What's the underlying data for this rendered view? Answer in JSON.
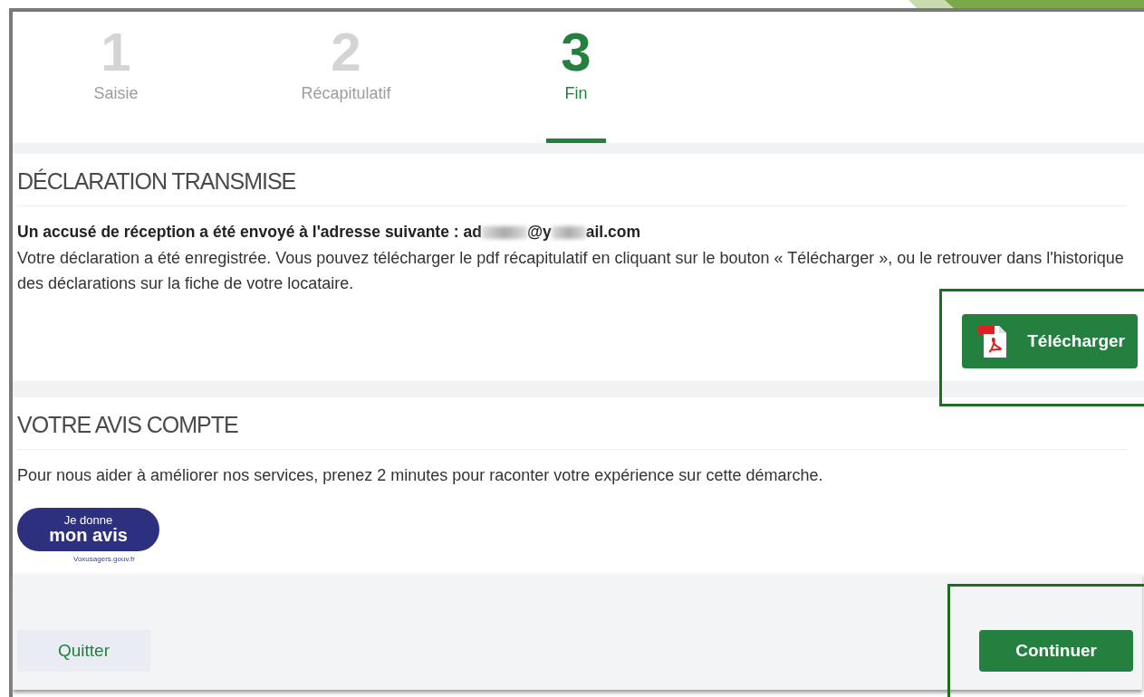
{
  "steps": [
    {
      "number": "1",
      "label": "Saisie",
      "selected": false
    },
    {
      "number": "2",
      "label": "Récapitulatif",
      "selected": false
    },
    {
      "number": "3",
      "label": "Fin",
      "selected": true
    }
  ],
  "confirmation": {
    "title": "DÉCLARATION TRANSMISE",
    "receipt_label": "Un accusé de réception a été envoyé à l'adresse suivante :",
    "email_parts": [
      "ad",
      "@y",
      "ail.com"
    ],
    "message": "Votre déclaration a été enregistrée. Vous pouvez télécharger le pdf récapitulatif en cliquant sur le bouton « Télécharger », ou le retrouver dans l'historique des déclarations sur la fiche de votre locataire.",
    "download_button": "Télécharger"
  },
  "feedback": {
    "title": "VOTRE AVIS COMPTE",
    "message": "Pour nous aider à améliorer nos services, prenez 2 minutes pour raconter votre expérience sur cette démarche.",
    "badge_top": "Je donne",
    "badge_bottom": "mon avis",
    "badge_source": "Voxusagers.gouv.fr"
  },
  "footer": {
    "quit_button": "Quitter",
    "continue_button": "Continuer"
  }
}
